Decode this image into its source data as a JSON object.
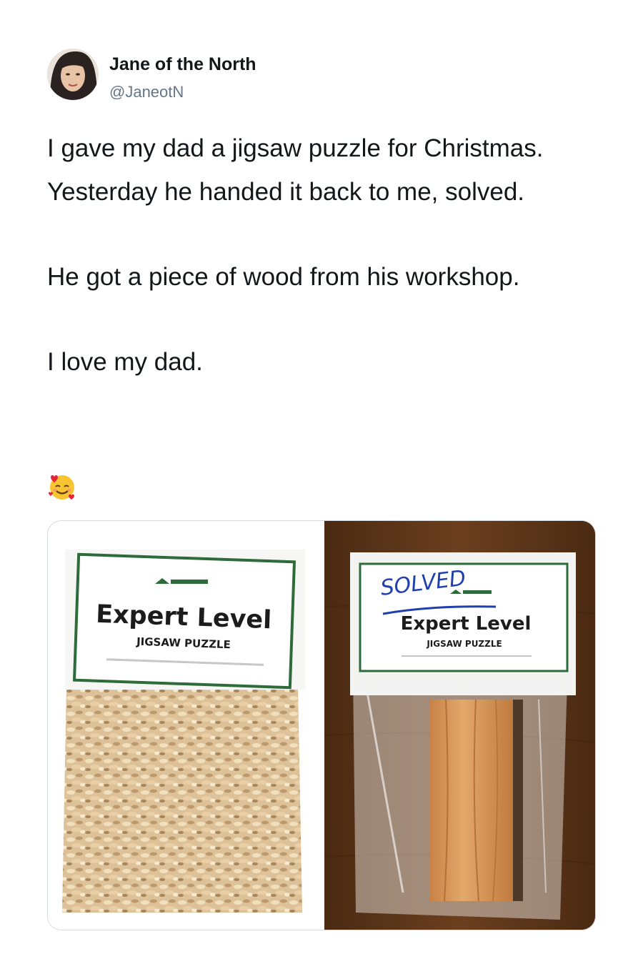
{
  "author": {
    "name": "Jane of the North",
    "handle": "@JaneotN"
  },
  "tweet": {
    "paragraphs": [
      "I gave my dad a jigsaw puzzle for Christmas. Yesterday he handed it back to me, solved.",
      "He got a piece of wood from his workshop.",
      "I love my dad."
    ],
    "emoji": "smiling-face-with-hearts"
  },
  "media": {
    "left_image": {
      "label_title": "Expert Level",
      "label_subtitle": "JIGSAW PUZZLE"
    },
    "right_image": {
      "handwritten": "SOLVED",
      "label_title": "Expert Level",
      "label_subtitle": "JIGSAW PUZZLE"
    }
  },
  "colors": {
    "label_border": "#2e6b3a",
    "ink": "#1f3fb0",
    "wood_table": "#5a3418",
    "wood_block": "#d99a5b"
  }
}
